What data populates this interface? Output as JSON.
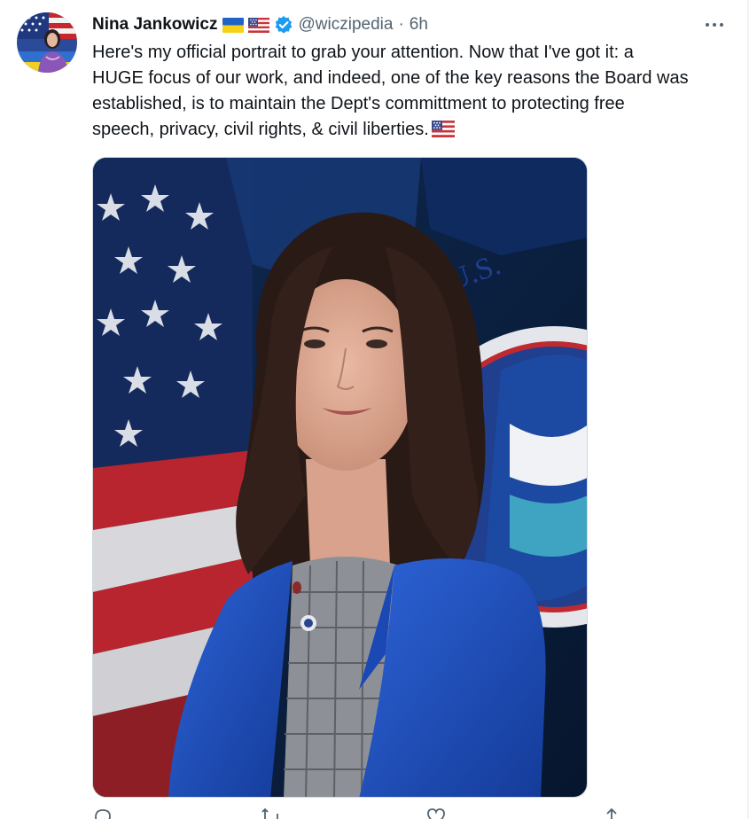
{
  "tweet": {
    "author_name": "Nina Jankowicz",
    "handle": "@wiczipedia",
    "separator": "·",
    "time": "6h",
    "flags": [
      "ukraine-flag-icon",
      "usa-flag-icon"
    ],
    "verified_badge": "verified-badge-icon",
    "more_icon": "more-options-icon",
    "text_lines": [
      "Here's my official portrait to grab your attention. Now that I've got it: a",
      "HUGE focus of our work, and indeed, one of the key reasons the Board was",
      "established, is to maintain the Dept's committment to protecting free",
      "speech, privacy, civil rights, & civil liberties."
    ],
    "trailing_emoji": "usa-flag-icon",
    "media": "portrait-photo",
    "actions": [
      "reply-icon",
      "retweet-icon",
      "like-icon",
      "share-icon"
    ]
  },
  "colors": {
    "text_primary": "#0f1419",
    "text_secondary": "#536471",
    "verified_blue": "#1d9bf0",
    "border": "#cfd9de"
  }
}
